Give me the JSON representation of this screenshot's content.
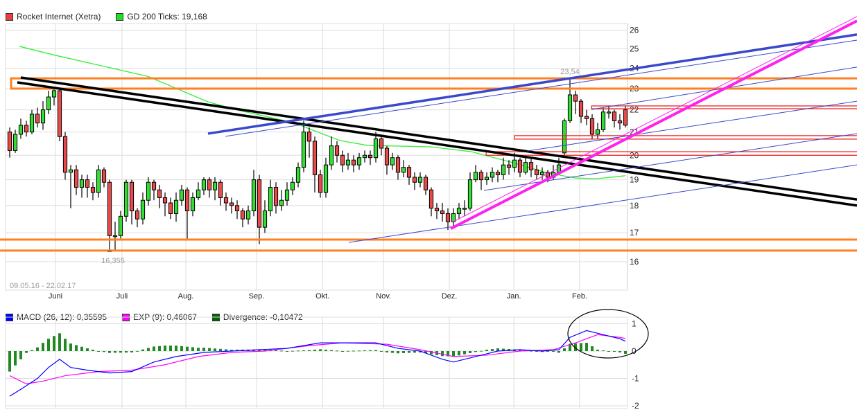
{
  "legend_price": [
    {
      "label": "Rocket Internet (Xetra)",
      "color": "#e84040"
    },
    {
      "label": "GD 200 Ticks: 19,168",
      "color": "#22dd22"
    }
  ],
  "legend_macd": [
    {
      "label": "MACD (26, 12): 0,35595",
      "color": "#0000ff"
    },
    {
      "label": "EXP (9): 0,46067",
      "color": "#ff00ff"
    },
    {
      "label": "Divergence: -0,10472",
      "color": "#006600"
    }
  ],
  "chart_data": [
    {
      "type": "candlestick",
      "title": "Rocket Internet (Xetra)",
      "date_range": "09.05.16 - 22.02.17",
      "y_scale": "log",
      "ylim": [
        16,
        26.3
      ],
      "y_ticks": [
        "16",
        "17",
        "18",
        "19",
        "20",
        "21",
        "22",
        "23",
        "24",
        "25",
        "26"
      ],
      "slots": 112,
      "months": [
        {
          "label": "Juni",
          "slot": 8.75
        },
        {
          "label": "Juli",
          "slot": 20.75
        },
        {
          "label": "Aug.",
          "slot": 32.25
        },
        {
          "label": "Sep.",
          "slot": 45
        },
        {
          "label": "Okt.",
          "slot": 56.9
        },
        {
          "label": "Nov.",
          "slot": 67.9
        },
        {
          "label": "Dez.",
          "slot": 79.75
        },
        {
          "label": "Jan.",
          "slot": 91.4
        },
        {
          "label": "Feb.",
          "slot": 103.25
        }
      ],
      "open": [
        21.0,
        20.2,
        20.9,
        21.3,
        21.0,
        21.8,
        21.4,
        22.0,
        22.6,
        22.9,
        20.8,
        19.3,
        19.4,
        18.7,
        19.0,
        18.7,
        18.5,
        19.4,
        18.9,
        16.9,
        16.9,
        17.6,
        18.9,
        17.8,
        17.5,
        18.2,
        18.9,
        18.6,
        18.3,
        18.1,
        17.7,
        18.2,
        18.6,
        17.8,
        18.3,
        18.6,
        19.0,
        18.6,
        18.9,
        18.3,
        18.1,
        18.0,
        17.8,
        17.5,
        17.8,
        19.0,
        17.2,
        17.8,
        18.7,
        18.0,
        18.2,
        18.6,
        18.9,
        19.5,
        21.0,
        20.6,
        19.2,
        18.5,
        19.6,
        20.4,
        20.0,
        19.6,
        19.8,
        19.6,
        19.9,
        20.0,
        19.9,
        20.7,
        20.3,
        19.6,
        19.9,
        19.3,
        19.5,
        19.1,
        18.9,
        19.1,
        18.6,
        17.9,
        17.8,
        17.7,
        17.4,
        17.7,
        17.9,
        17.9,
        19.0,
        19.3,
        19.0,
        19.1,
        19.3,
        19.2,
        19.6,
        19.5,
        19.8,
        19.3,
        19.7,
        19.4,
        19.2,
        19.3,
        19.1,
        19.3,
        20.1,
        21.5,
        22.7,
        22.4,
        21.7,
        21.6,
        20.9,
        21.1,
        21.9,
        21.9,
        21.5,
        22.0
      ],
      "high": [
        21.2,
        21.1,
        21.6,
        21.5,
        22.0,
        22.1,
        22.4,
        22.9,
        23.1,
        23.0,
        21.0,
        19.6,
        19.6,
        19.2,
        19.2,
        18.9,
        19.6,
        19.5,
        19.0,
        17.4,
        17.8,
        19.0,
        19.0,
        17.9,
        18.5,
        19.1,
        19.0,
        18.8,
        18.5,
        18.3,
        18.5,
        18.8,
        18.7,
        18.5,
        18.9,
        19.1,
        19.1,
        19.1,
        19.0,
        18.5,
        18.3,
        18.2,
        17.9,
        18.0,
        19.4,
        19.2,
        18.2,
        19.0,
        18.9,
        18.6,
        18.9,
        19.1,
        19.7,
        21.5,
        21.2,
        20.8,
        19.4,
        19.9,
        20.8,
        20.6,
        20.2,
        20.1,
        20.0,
        20.1,
        20.2,
        20.2,
        21.0,
        20.8,
        20.4,
        20.1,
        20.0,
        19.8,
        19.6,
        19.3,
        19.3,
        19.2,
        18.7,
        18.1,
        18.1,
        17.9,
        17.9,
        18.1,
        18.2,
        19.3,
        19.6,
        19.4,
        19.3,
        19.5,
        19.4,
        19.9,
        19.8,
        20.1,
        19.9,
        20.0,
        19.9,
        19.6,
        19.5,
        19.4,
        19.6,
        19.9,
        21.6,
        23.54,
        22.9,
        22.5,
        22.0,
        21.8,
        21.4,
        22.1,
        22.2,
        22.0,
        21.8,
        22.2
      ],
      "low": [
        19.9,
        20.1,
        20.7,
        20.8,
        20.9,
        21.2,
        21.1,
        21.8,
        22.2,
        20.6,
        19.0,
        17.9,
        18.4,
        18.3,
        18.3,
        18.2,
        18.3,
        18.7,
        16.355,
        16.4,
        16.8,
        17.4,
        17.3,
        17.2,
        17.3,
        18.0,
        18.2,
        17.9,
        17.6,
        17.5,
        17.4,
        18.0,
        16.8,
        17.6,
        18.2,
        18.4,
        18.3,
        18.2,
        18.0,
        17.8,
        17.7,
        17.5,
        17.2,
        17.3,
        17.6,
        16.6,
        17.0,
        17.6,
        17.7,
        17.8,
        18.0,
        18.4,
        18.7,
        19.3,
        19.9,
        18.5,
        18.3,
        18.3,
        19.4,
        19.7,
        19.3,
        19.4,
        19.3,
        19.4,
        19.7,
        19.6,
        19.7,
        20.0,
        19.2,
        19.4,
        19.0,
        19.1,
        18.8,
        18.6,
        18.7,
        18.4,
        17.6,
        17.5,
        17.4,
        17.1,
        17.2,
        17.5,
        17.6,
        17.8,
        18.9,
        18.6,
        18.8,
        18.9,
        18.9,
        19.0,
        19.2,
        19.3,
        19.1,
        19.2,
        19.1,
        19.0,
        19.0,
        18.9,
        19.0,
        19.2,
        20.0,
        21.4,
        21.8,
        21.4,
        21.3,
        20.7,
        20.7,
        21.0,
        21.6,
        21.2,
        21.1,
        21.2
      ],
      "close": [
        20.2,
        20.9,
        21.3,
        21.0,
        21.8,
        21.4,
        22.0,
        22.6,
        22.9,
        20.8,
        19.3,
        19.4,
        18.7,
        19.0,
        18.7,
        18.5,
        19.4,
        18.9,
        16.9,
        16.9,
        17.6,
        18.9,
        17.8,
        17.5,
        18.2,
        18.9,
        18.6,
        18.3,
        18.1,
        17.7,
        18.2,
        18.6,
        17.8,
        18.3,
        18.6,
        19.0,
        18.6,
        18.9,
        18.3,
        18.1,
        18.0,
        17.8,
        17.5,
        17.8,
        19.0,
        17.2,
        17.8,
        18.7,
        18.0,
        18.2,
        18.6,
        18.9,
        19.5,
        21.0,
        20.6,
        19.2,
        18.5,
        19.6,
        20.4,
        20.0,
        19.6,
        19.8,
        19.6,
        19.9,
        20.0,
        19.9,
        20.7,
        20.3,
        19.6,
        19.9,
        19.3,
        19.5,
        19.1,
        18.9,
        19.1,
        18.6,
        17.9,
        17.8,
        17.7,
        17.4,
        17.7,
        17.9,
        17.9,
        19.0,
        19.3,
        19.0,
        19.1,
        19.3,
        19.2,
        19.6,
        19.5,
        19.8,
        19.3,
        19.7,
        19.4,
        19.2,
        19.3,
        19.1,
        19.3,
        19.6,
        21.5,
        22.7,
        22.4,
        21.7,
        21.6,
        20.9,
        21.1,
        21.9,
        21.9,
        21.5,
        21.4,
        21.3
      ],
      "gd200": [
        [
          2.25,
          25.13
        ],
        [
          8.75,
          24.66
        ],
        [
          25.4,
          23.6
        ],
        [
          36.25,
          22.37
        ],
        [
          42.1,
          21.96
        ],
        [
          51.6,
          21.42
        ],
        [
          60,
          20.63
        ],
        [
          65,
          20.42
        ],
        [
          76.25,
          20.36
        ],
        [
          83.75,
          20.15
        ],
        [
          91.25,
          19.69
        ],
        [
          97.5,
          19.27
        ],
        [
          102.5,
          19.07
        ],
        [
          106.25,
          19.04
        ],
        [
          111.5,
          19.16
        ]
      ],
      "annotations": {
        "max_label": {
          "text": "23,54",
          "slot": 101,
          "value": 23.54
        },
        "min_label": {
          "text": "16,355",
          "slot": 18,
          "value": 16.355
        },
        "trend_lines": [
          {
            "color": "#000000",
            "weight": "thick",
            "from": [
              2.5,
              23.54
            ],
            "to": [
              153.25,
              18.23
            ]
          },
          {
            "color": "#000000",
            "weight": "thick",
            "from": [
              1.875,
              23.3
            ],
            "to": [
              153.25,
              18.0
            ]
          },
          {
            "color": "#3a48cc",
            "weight": "thick",
            "from": [
              36.25,
              20.93
            ],
            "to": [
              153.25,
              25.76
            ]
          },
          {
            "color": "#3a48cc",
            "weight": "thin",
            "from": [
              39.4,
              20.81
            ],
            "to": [
              153.25,
              25.46
            ]
          },
          {
            "color": "#3a48cc",
            "weight": "thin",
            "from": [
              105.4,
              22.02
            ],
            "to": [
              153.25,
              24.06
            ]
          },
          {
            "color": "#3a48cc",
            "weight": "thin",
            "from": [
              93.75,
              20.18
            ],
            "to": [
              153.25,
              22.4
            ]
          },
          {
            "color": "#3a48cc",
            "weight": "thin",
            "from": [
              86,
              18.58
            ],
            "to": [
              153.25,
              20.93
            ]
          },
          {
            "color": "#3a48cc",
            "weight": "thin",
            "from": [
              61.6,
              16.66
            ],
            "to": [
              153.25,
              19.6
            ]
          },
          {
            "color": "#ff22ee",
            "weight": "heavy",
            "from": [
              80,
              17.15
            ],
            "to": [
              153.25,
              26.51
            ]
          },
          {
            "color": "#ff22ee",
            "weight": "thin",
            "from": [
              80.25,
              17.38
            ],
            "to": [
              153.25,
              26.75
            ]
          }
        ],
        "horizontal_lines": [
          {
            "color": "#ff8020",
            "value": 16.76
          },
          {
            "color": "#ff8020",
            "value": 16.38
          }
        ],
        "zones": [
          {
            "color": "#ff8020",
            "from_slot": 0.75,
            "range": [
              23.0,
              23.5
            ]
          },
          {
            "color": "#ee2222",
            "from_slot": 105.4,
            "range": [
              22.05,
              22.18
            ]
          },
          {
            "color": "#ee2222",
            "from_slot": 91.5,
            "range": [
              20.69,
              20.84
            ]
          },
          {
            "color": "#ee2222",
            "from_slot": 86.4,
            "range": [
              20.0,
              20.15
            ]
          }
        ]
      }
    },
    {
      "type": "line",
      "title": "MACD",
      "ylim": [
        -2.1,
        1.1
      ],
      "y_ticks": [
        "1",
        "0",
        "-1",
        "-2"
      ],
      "macd": [
        [
          0,
          -1.65
        ],
        [
          2,
          -1.4
        ],
        [
          5,
          -1.0
        ],
        [
          7,
          -0.6
        ],
        [
          9,
          -0.3
        ],
        [
          11,
          -0.6
        ],
        [
          14,
          -0.7
        ],
        [
          18,
          -0.8
        ],
        [
          22,
          -0.75
        ],
        [
          26,
          -0.4
        ],
        [
          30,
          -0.2
        ],
        [
          35,
          -0.05
        ],
        [
          40,
          0.0
        ],
        [
          45,
          0.05
        ],
        [
          50,
          0.1
        ],
        [
          53,
          0.2
        ],
        [
          56,
          0.3
        ],
        [
          60,
          0.3
        ],
        [
          66,
          0.3
        ],
        [
          70,
          0.1
        ],
        [
          74,
          0.0
        ],
        [
          78,
          -0.3
        ],
        [
          80,
          -0.4
        ],
        [
          84,
          -0.2
        ],
        [
          88,
          0.0
        ],
        [
          92,
          0.05
        ],
        [
          96,
          0.0
        ],
        [
          99,
          0.05
        ],
        [
          101,
          0.5
        ],
        [
          104,
          0.75
        ],
        [
          106,
          0.65
        ],
        [
          108,
          0.55
        ],
        [
          110,
          0.45
        ],
        [
          111,
          0.36
        ]
      ],
      "exp": [
        [
          0,
          -0.9
        ],
        [
          3,
          -1.2
        ],
        [
          6,
          -1.1
        ],
        [
          10,
          -0.9
        ],
        [
          16,
          -0.75
        ],
        [
          22,
          -0.7
        ],
        [
          28,
          -0.5
        ],
        [
          34,
          -0.2
        ],
        [
          40,
          -0.05
        ],
        [
          46,
          0.0
        ],
        [
          54,
          0.2
        ],
        [
          60,
          0.3
        ],
        [
          68,
          0.25
        ],
        [
          74,
          0.05
        ],
        [
          80,
          -0.2
        ],
        [
          86,
          -0.15
        ],
        [
          92,
          0.0
        ],
        [
          98,
          0.05
        ],
        [
          102,
          0.3
        ],
        [
          106,
          0.6
        ],
        [
          110,
          0.5
        ],
        [
          111,
          0.46
        ]
      ],
      "divergence": "macd - exp"
    }
  ]
}
